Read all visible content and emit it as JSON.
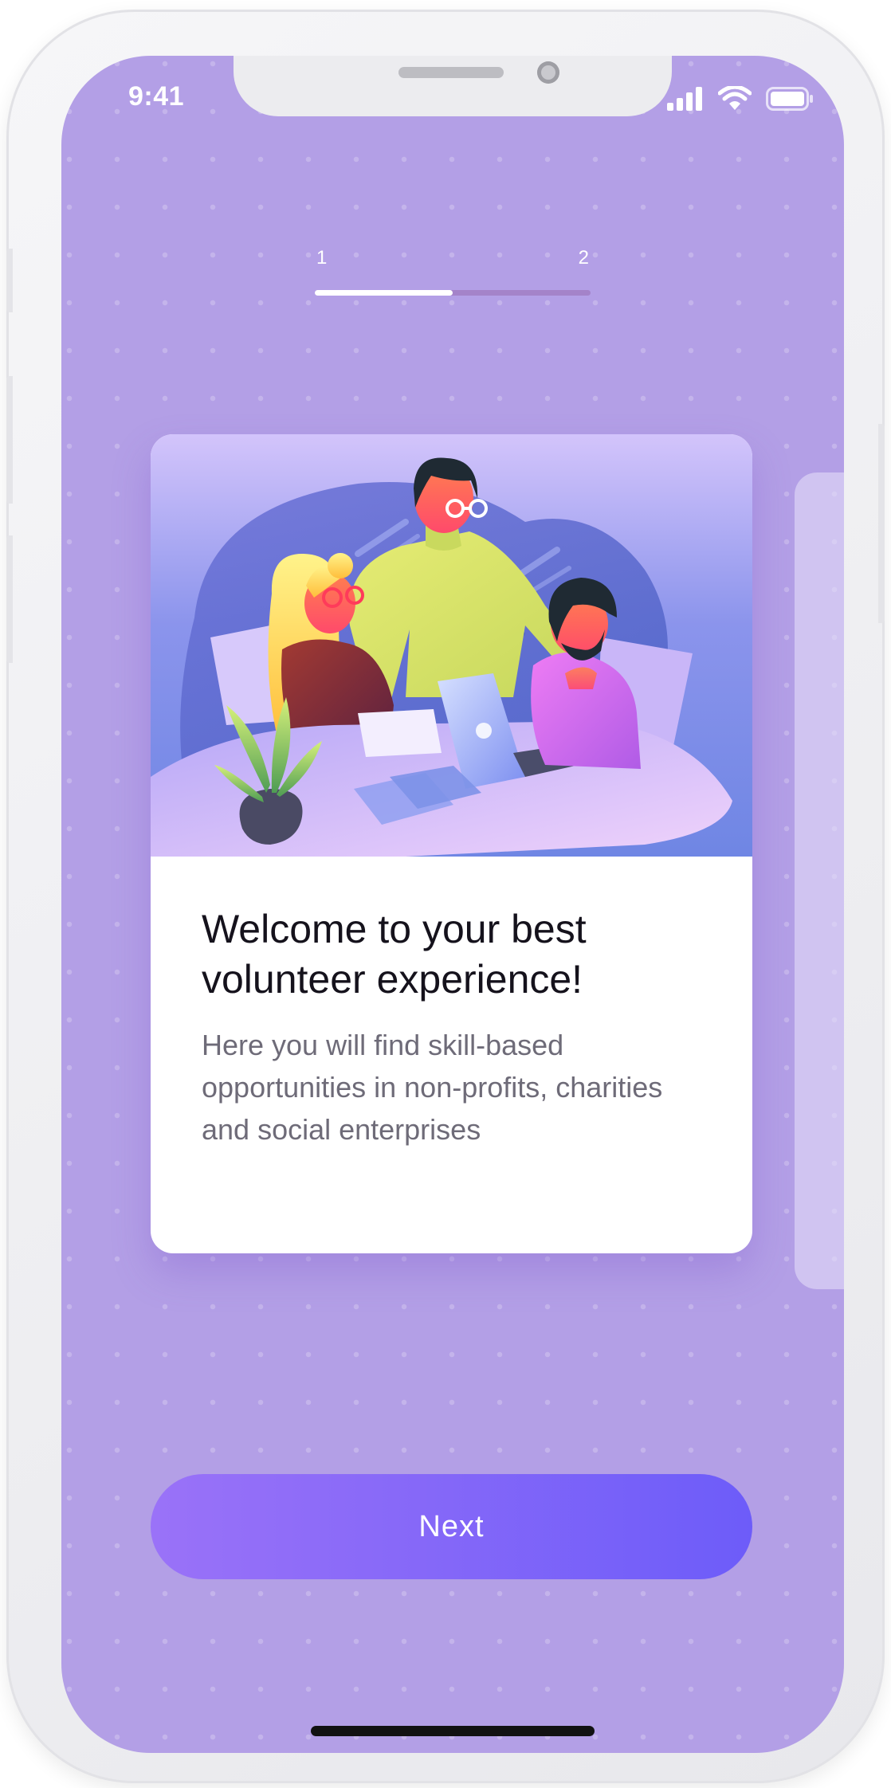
{
  "status_bar": {
    "time": "9:41",
    "icons": [
      "cellular-signal-icon",
      "wifi-icon",
      "battery-icon"
    ]
  },
  "progress": {
    "step_start_label": "1",
    "step_end_label": "2",
    "current_step": 1,
    "total_steps": 2,
    "fill_fraction": 0.5
  },
  "card": {
    "illustration": "team-meeting-illustration",
    "title": "Welcome to your best volunteer experience!",
    "body": "Here you will find skill-based opportunities in non-profits, charities and social enterprises"
  },
  "actions": {
    "next_label": "Next"
  },
  "colors": {
    "background": "#b39fe6",
    "accent_start": "#9a72f8",
    "accent_end": "#6d5cf9",
    "progress_fill": "#ffffff",
    "progress_track": "#a483c9",
    "title_text": "#15121c",
    "body_text": "#6e6b78"
  }
}
